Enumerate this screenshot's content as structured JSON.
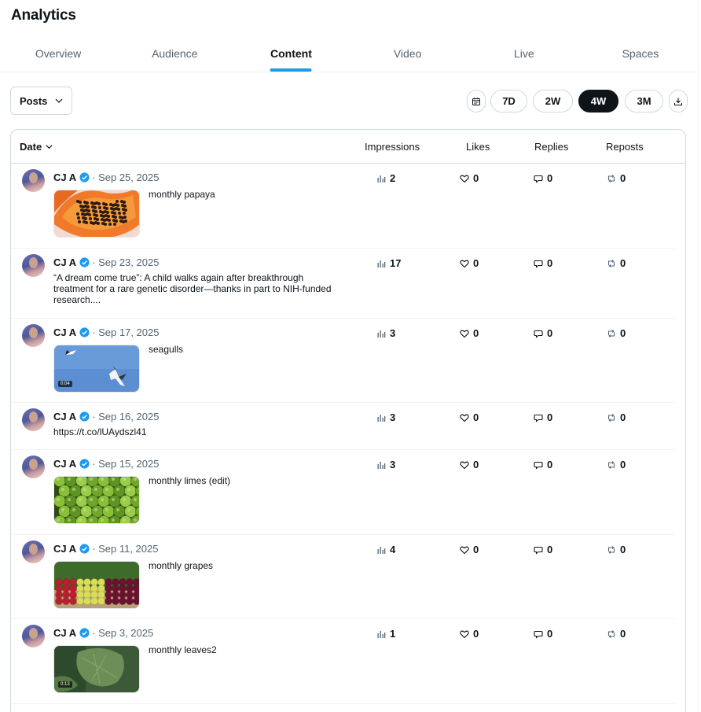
{
  "page_title": "Analytics",
  "tabs": [
    {
      "label": "Overview",
      "active": false
    },
    {
      "label": "Audience",
      "active": false
    },
    {
      "label": "Content",
      "active": true
    },
    {
      "label": "Video",
      "active": false
    },
    {
      "label": "Live",
      "active": false
    },
    {
      "label": "Spaces",
      "active": false
    }
  ],
  "filter": {
    "selected": "Posts"
  },
  "ranges": [
    "7D",
    "2W",
    "4W",
    "3M"
  ],
  "selected_range": "4W",
  "table": {
    "columns": {
      "date": "Date",
      "impressions": "Impressions",
      "likes": "Likes",
      "replies": "Replies",
      "reposts": "Reposts"
    },
    "rows": [
      {
        "author": "CJ A",
        "date": "· Sep 25, 2025",
        "text": "monthly papaya",
        "media": "papaya",
        "duration": "",
        "impressions": "2",
        "likes": "0",
        "replies": "0",
        "reposts": "0"
      },
      {
        "author": "CJ A",
        "date": "· Sep 23, 2025",
        "text": "“A dream come true”: A child walks again after breakthrough treatment for a rare genetic disorder—thanks in part to NIH-funded research....",
        "media": "",
        "duration": "",
        "impressions": "17",
        "likes": "0",
        "replies": "0",
        "reposts": "0"
      },
      {
        "author": "CJ A",
        "date": "· Sep 17, 2025",
        "text": "seagulls",
        "media": "seagulls",
        "duration": "0:04",
        "impressions": "3",
        "likes": "0",
        "replies": "0",
        "reposts": "0"
      },
      {
        "author": "CJ A",
        "date": "· Sep 16, 2025",
        "text": "https://t.co/lUAydszl41",
        "media": "",
        "duration": "",
        "impressions": "3",
        "likes": "0",
        "replies": "0",
        "reposts": "0"
      },
      {
        "author": "CJ A",
        "date": "· Sep 15, 2025",
        "text": "monthly limes (edit)",
        "media": "limes",
        "duration": "",
        "impressions": "3",
        "likes": "0",
        "replies": "0",
        "reposts": "0"
      },
      {
        "author": "CJ A",
        "date": "· Sep 11, 2025",
        "text": "monthly grapes",
        "media": "grapes",
        "duration": "",
        "impressions": "4",
        "likes": "0",
        "replies": "0",
        "reposts": "0"
      },
      {
        "author": "CJ A",
        "date": "· Sep 3, 2025",
        "text": "monthly leaves2",
        "media": "leaves",
        "duration": "0:13",
        "impressions": "1",
        "likes": "0",
        "replies": "0",
        "reposts": "0"
      }
    ]
  },
  "colors": {
    "accent": "#1d9bf0",
    "text": "#0f1419",
    "secondary": "#536471",
    "border": "#cfd9de"
  }
}
